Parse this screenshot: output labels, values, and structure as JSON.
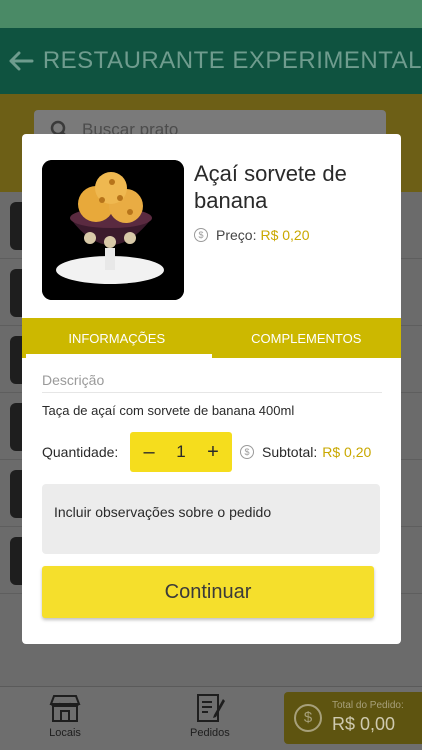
{
  "app": {
    "title": "RESTAURANTE EXPERIMENTAL",
    "search_placeholder": "Buscar prato"
  },
  "bottom_nav": {
    "locais": "Locais",
    "pedidos": "Pedidos",
    "total_label": "Total do Pedido:",
    "total_value": "R$ 0,00"
  },
  "product": {
    "name": "Açaí sorvete de banana",
    "price_label": "Preço:",
    "price_value": "R$ 0,20"
  },
  "tabs": [
    {
      "label": "INFORMAÇÕES",
      "active": true
    },
    {
      "label": "COMPLEMENTOS",
      "active": false
    }
  ],
  "info": {
    "description_label": "Descrição",
    "description_text": "Taça de açaí com sorvete de banana 400ml",
    "quantity_label": "Quantidade:",
    "quantity_value": "1",
    "minus": "–",
    "plus": "+",
    "subtotal_label": "Subtotal:",
    "subtotal_value": "R$ 0,20",
    "notes_placeholder": "Incluir observações sobre o pedido",
    "continue_label": "Continuar"
  },
  "colors": {
    "accent_yellow": "#f5df2c",
    "tab_bar": "#ccb800",
    "price_text": "#c9a800"
  }
}
